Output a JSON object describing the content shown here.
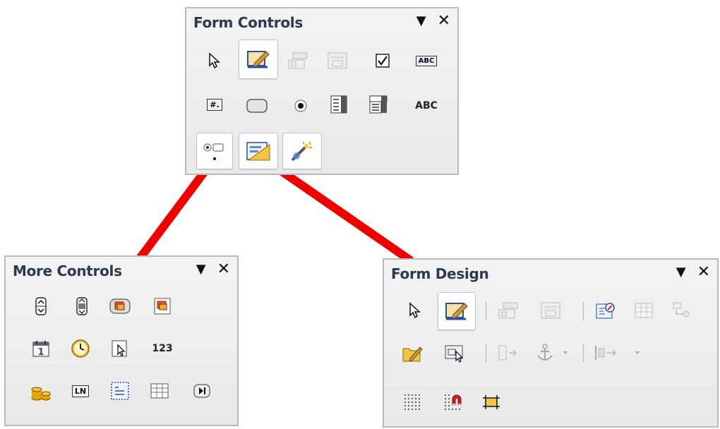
{
  "form_controls": {
    "title": "Form Controls",
    "menu_icon": "dropdown-arrow-icon",
    "close_icon": "close-icon",
    "items": [
      {
        "name": "select-icon",
        "active": false
      },
      {
        "name": "design-mode-icon",
        "active": true
      },
      {
        "name": "control-properties-icon",
        "active": false,
        "disabled": true
      },
      {
        "name": "form-properties-icon",
        "active": false,
        "disabled": true
      },
      {
        "name": "check-box-icon"
      },
      {
        "name": "text-box-icon",
        "label": "ABC"
      },
      {
        "name": "formatted-field-icon",
        "label": "#."
      },
      {
        "name": "push-button-icon"
      },
      {
        "name": "option-button-icon"
      },
      {
        "name": "list-box-icon"
      },
      {
        "name": "combo-box-icon"
      },
      {
        "name": "label-field-icon",
        "label": "ABC"
      },
      {
        "name": "more-controls-icon",
        "active": true
      },
      {
        "name": "form-design-icon",
        "active": true
      },
      {
        "name": "wizards-icon",
        "active": true
      }
    ]
  },
  "more_controls": {
    "title": "More Controls",
    "menu_icon": "dropdown-arrow-icon",
    "close_icon": "close-icon",
    "items": [
      {
        "name": "spin-button-icon"
      },
      {
        "name": "scrollbar-icon"
      },
      {
        "name": "image-button-icon"
      },
      {
        "name": "image-control-icon"
      },
      {
        "name": "date-field-icon",
        "label": "1"
      },
      {
        "name": "time-field-icon"
      },
      {
        "name": "file-selection-icon"
      },
      {
        "name": "numerical-field-icon",
        "label": "123"
      },
      {
        "name": "currency-field-icon"
      },
      {
        "name": "pattern-field-icon",
        "label": "LN"
      },
      {
        "name": "group-box-icon"
      },
      {
        "name": "table-control-icon"
      },
      {
        "name": "navigation-bar-icon"
      }
    ]
  },
  "form_design": {
    "title": "Form Design",
    "menu_icon": "dropdown-arrow-icon",
    "close_icon": "close-icon",
    "items": [
      {
        "name": "select-icon"
      },
      {
        "name": "design-mode-icon",
        "active": true
      },
      {
        "name": "control-properties-icon",
        "disabled": true
      },
      {
        "name": "form-properties-icon",
        "disabled": true
      },
      {
        "name": "form-navigator-icon"
      },
      {
        "name": "activation-order-icon",
        "disabled": true
      },
      {
        "name": "add-field-icon",
        "disabled": true
      },
      {
        "name": "open-in-design-mode-icon"
      },
      {
        "name": "automatic-control-focus-icon"
      },
      {
        "name": "position-and-size-icon",
        "disabled": true
      },
      {
        "name": "anchor-icon",
        "disabled": true
      },
      {
        "name": "alignment-icon",
        "disabled": true
      },
      {
        "name": "display-grid-icon"
      },
      {
        "name": "snap-to-grid-icon"
      },
      {
        "name": "helplines-while-moving-icon"
      }
    ]
  },
  "connector_color": "#ee0000"
}
